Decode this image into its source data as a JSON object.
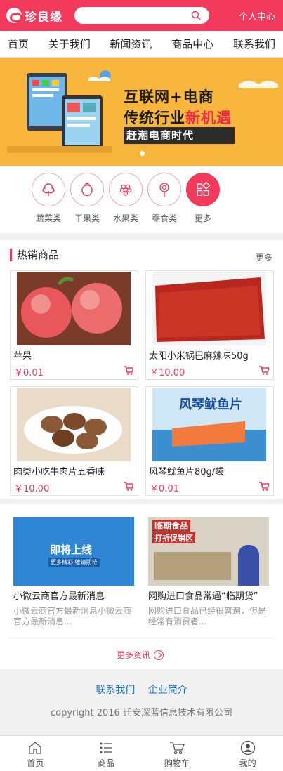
{
  "header": {
    "logo_text": "珍良缘",
    "search_placeholder": "",
    "user_center": "个人中心"
  },
  "nav": {
    "items": [
      "首页",
      "关于我们",
      "新闻资讯",
      "商品中心",
      "联系我们"
    ]
  },
  "banner": {
    "line1": "互联网+电商",
    "line2_prefix": "传统行业",
    "line2_highlight": "新机遇",
    "line3": "赶潮电商时代"
  },
  "categories": [
    {
      "label": "蔬菜类",
      "icon": "vegetable-icon"
    },
    {
      "label": "干果类",
      "icon": "dried-fruit-icon"
    },
    {
      "label": "水果类",
      "icon": "grape-icon"
    },
    {
      "label": "零食类",
      "icon": "lollipop-icon"
    },
    {
      "label": "更多",
      "icon": "grid-icon"
    }
  ],
  "hot": {
    "title": "热销商品",
    "more": "更多",
    "products": [
      {
        "name": "苹果",
        "price": "￥0.01"
      },
      {
        "name": "太阳小米锅巴麻辣味50g",
        "price": "￥10.00"
      },
      {
        "name": "肉类小吃牛肉片五香味",
        "price": "￥10.00"
      },
      {
        "name": "风琴鱿鱼片80g/袋",
        "price": "￥0.01"
      }
    ]
  },
  "news": {
    "items": [
      {
        "title": "小微云商官方最新消息",
        "desc": "小微云商官方最新消息小微云商官方最新消息...",
        "img_text_1": "即将上线",
        "img_text_2": "更多精彩 敬请期待"
      },
      {
        "title": "网购进口食品常遇“临期货”",
        "desc": "网购进口食品已经很普遍，但是经常有消费者...",
        "img_text_1": "临期食品",
        "img_text_2": "打折促销区"
      }
    ],
    "more": "更多资讯"
  },
  "footer": {
    "link1": "联系我们",
    "link2": "企业简介",
    "copyright": "copyright 2016 迁安深蓝信息技术有限公司"
  },
  "tabbar": [
    {
      "label": "首页",
      "icon": "home-icon"
    },
    {
      "label": "商品",
      "icon": "list-icon"
    },
    {
      "label": "购物车",
      "icon": "cart-icon"
    },
    {
      "label": "我的",
      "icon": "user-icon"
    }
  ],
  "colors": {
    "primary": "#f33a5c",
    "banner_bg": "#f8b73c",
    "link": "#1a6fc4"
  }
}
